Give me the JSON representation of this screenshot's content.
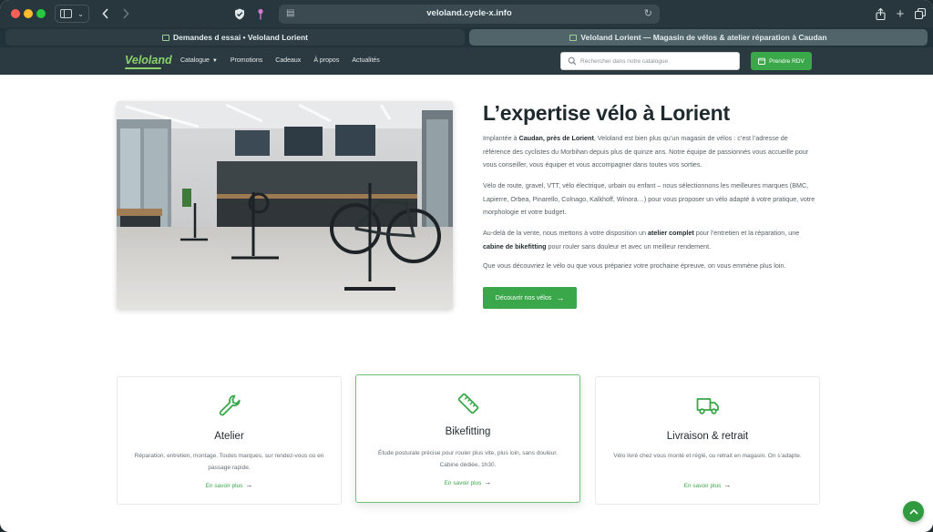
{
  "browser": {
    "url": "veloland.cycle-x.info",
    "tabs": [
      {
        "label": "Demandes d essai • Veloland Lorient"
      },
      {
        "label": "Veloland Lorient — Magasin de vélos & atelier réparation à Caudan"
      }
    ],
    "icons": [
      "sidebar-icon",
      "back-icon",
      "forward-icon",
      "shield-icon",
      "pin-icon",
      "reload-icon",
      "share-icon",
      "new-tab-icon",
      "tab-overview-icon"
    ]
  },
  "header": {
    "logo": "Veloland",
    "nav": [
      {
        "label": "Catalogue",
        "has_dropdown": true
      },
      {
        "label": "Promotions"
      },
      {
        "label": "Cadeaux"
      },
      {
        "label": "À propos"
      },
      {
        "label": "Actualités"
      }
    ],
    "search_placeholder": "Rechercher dans notre catalogue",
    "cta_label": "Prendre RDV",
    "accent": "#3aa84a",
    "background": "#2b3a40"
  },
  "hero": {
    "title": "L’expertise vélo à Lorient",
    "p1": {
      "pre": "Implantée à ",
      "bold": "Caudan, près de Lorient",
      "post": ", Veloland est bien plus qu’un magasin de vélos : c’est l’adresse de référence des cyclistes du Morbihan depuis plus de quinze ans. Notre équipe de passionnés vous accueille pour vous conseiller, vous équiper et vous accompagner dans toutes vos sorties."
    },
    "p2": "Vélo de route, gravel, VTT, vélo électrique, urbain ou enfant – nous sélectionnons les meilleures marques (BMC, Lapierre, Orbea, Pinarello, Colnago, Kalkhoff, Winora…) pour vous proposer un vélo adapté à votre pratique, votre morphologie et votre budget.",
    "p3": {
      "pre": "Au-delà de la vente, nous mettons à votre disposition un ",
      "bold1": "atelier complet",
      "mid": " pour l’entretien et la réparation, une ",
      "bold2": "cabine de bikefitting",
      "post": " pour rouler sans douleur et avec un meilleur rendement."
    },
    "p4": "Que vous découvriez le vélo ou que vous prépariez votre prochaine épreuve, on vous emmène plus loin.",
    "button_label": "Découvrir nos vélos"
  },
  "services": [
    {
      "icon": "wrench-icon",
      "title": "Atelier",
      "text": "Réparation, entretien, montage. Toutes marques, sur rendez-vous ou en passage rapide.",
      "link": "En savoir plus"
    },
    {
      "icon": "ruler-icon",
      "title": "Bikefitting",
      "text": "Étude posturale précise pour rouler plus vite, plus loin, sans douleur. Cabine dédiée, 1h30.",
      "link": "En savoir plus"
    },
    {
      "icon": "truck-icon",
      "title": "Livraison & retrait",
      "text": "Vélo livré chez vous monté et réglé, ou retrait en magasin. On s’adapte.",
      "link": "En savoir plus"
    }
  ]
}
